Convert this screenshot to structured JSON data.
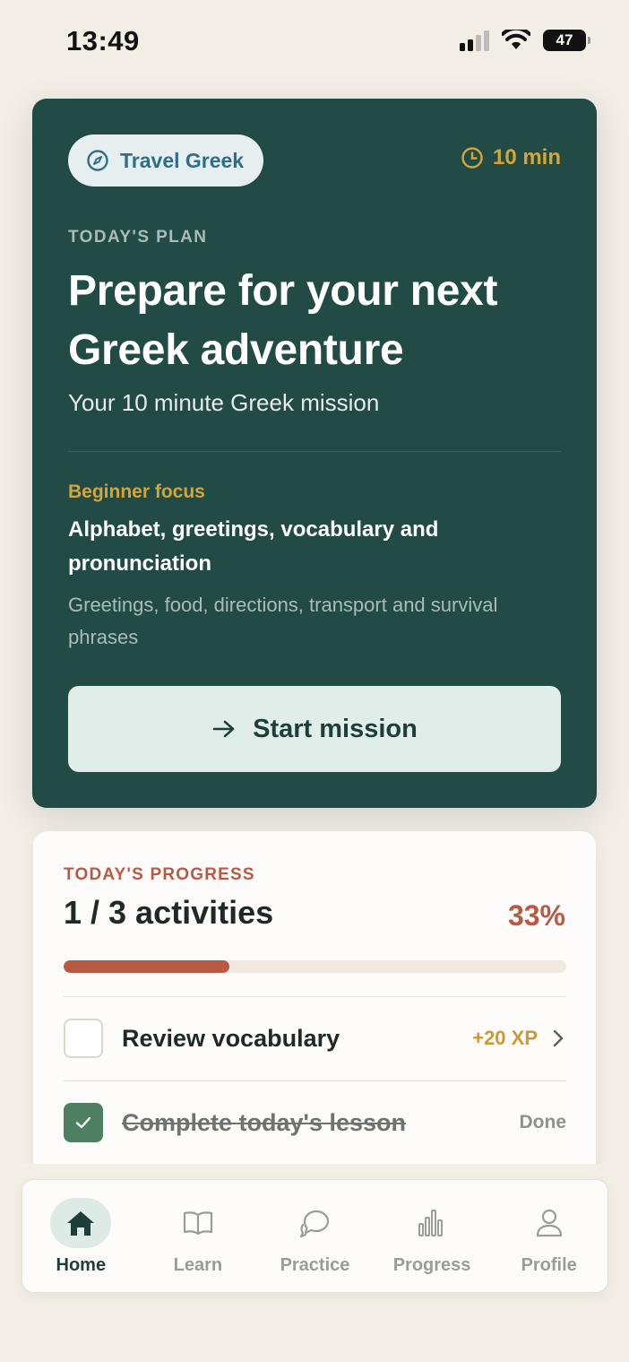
{
  "status_bar": {
    "time": "13:49",
    "battery": "47"
  },
  "hero": {
    "course_label": "Travel Greek",
    "duration": "10 min",
    "eyebrow": "TODAY'S PLAN",
    "title": "Prepare for your next Greek adventure",
    "subtitle": "Your 10 minute Greek mission",
    "focus_label": "Beginner focus",
    "focus_title": "Alphabet, greetings, vocabulary and pronunciation",
    "focus_desc": "Greetings, food, directions, transport and survival phrases",
    "start_button": "Start mission",
    "icons": {
      "course": "compass-icon",
      "duration": "clock-icon",
      "start": "arrow-right-icon"
    }
  },
  "progress": {
    "eyebrow": "TODAY'S PROGRESS",
    "count": "1 / 3 activities",
    "percent_label": "33%",
    "fraction": 0.33,
    "tasks": [
      {
        "label": "Review vocabulary",
        "xp": "+20 XP",
        "checked": false
      },
      {
        "label": "Complete today's lesson",
        "status": "Done",
        "checked": true
      }
    ]
  },
  "tabs": [
    {
      "label": "Home",
      "icon": "home-icon",
      "active": true
    },
    {
      "label": "Learn",
      "icon": "book-icon",
      "active": false
    },
    {
      "label": "Practice",
      "icon": "chat-icon",
      "active": false
    },
    {
      "label": "Progress",
      "icon": "bar-chart-icon",
      "active": false
    },
    {
      "label": "Profile",
      "icon": "user-icon",
      "active": false
    }
  ],
  "colors": {
    "background": "#f2eee6",
    "hero": "#234b45",
    "accent_gold": "#d4a53a",
    "accent_terracotta": "#b85a43",
    "check_green": "#4e7f63"
  }
}
